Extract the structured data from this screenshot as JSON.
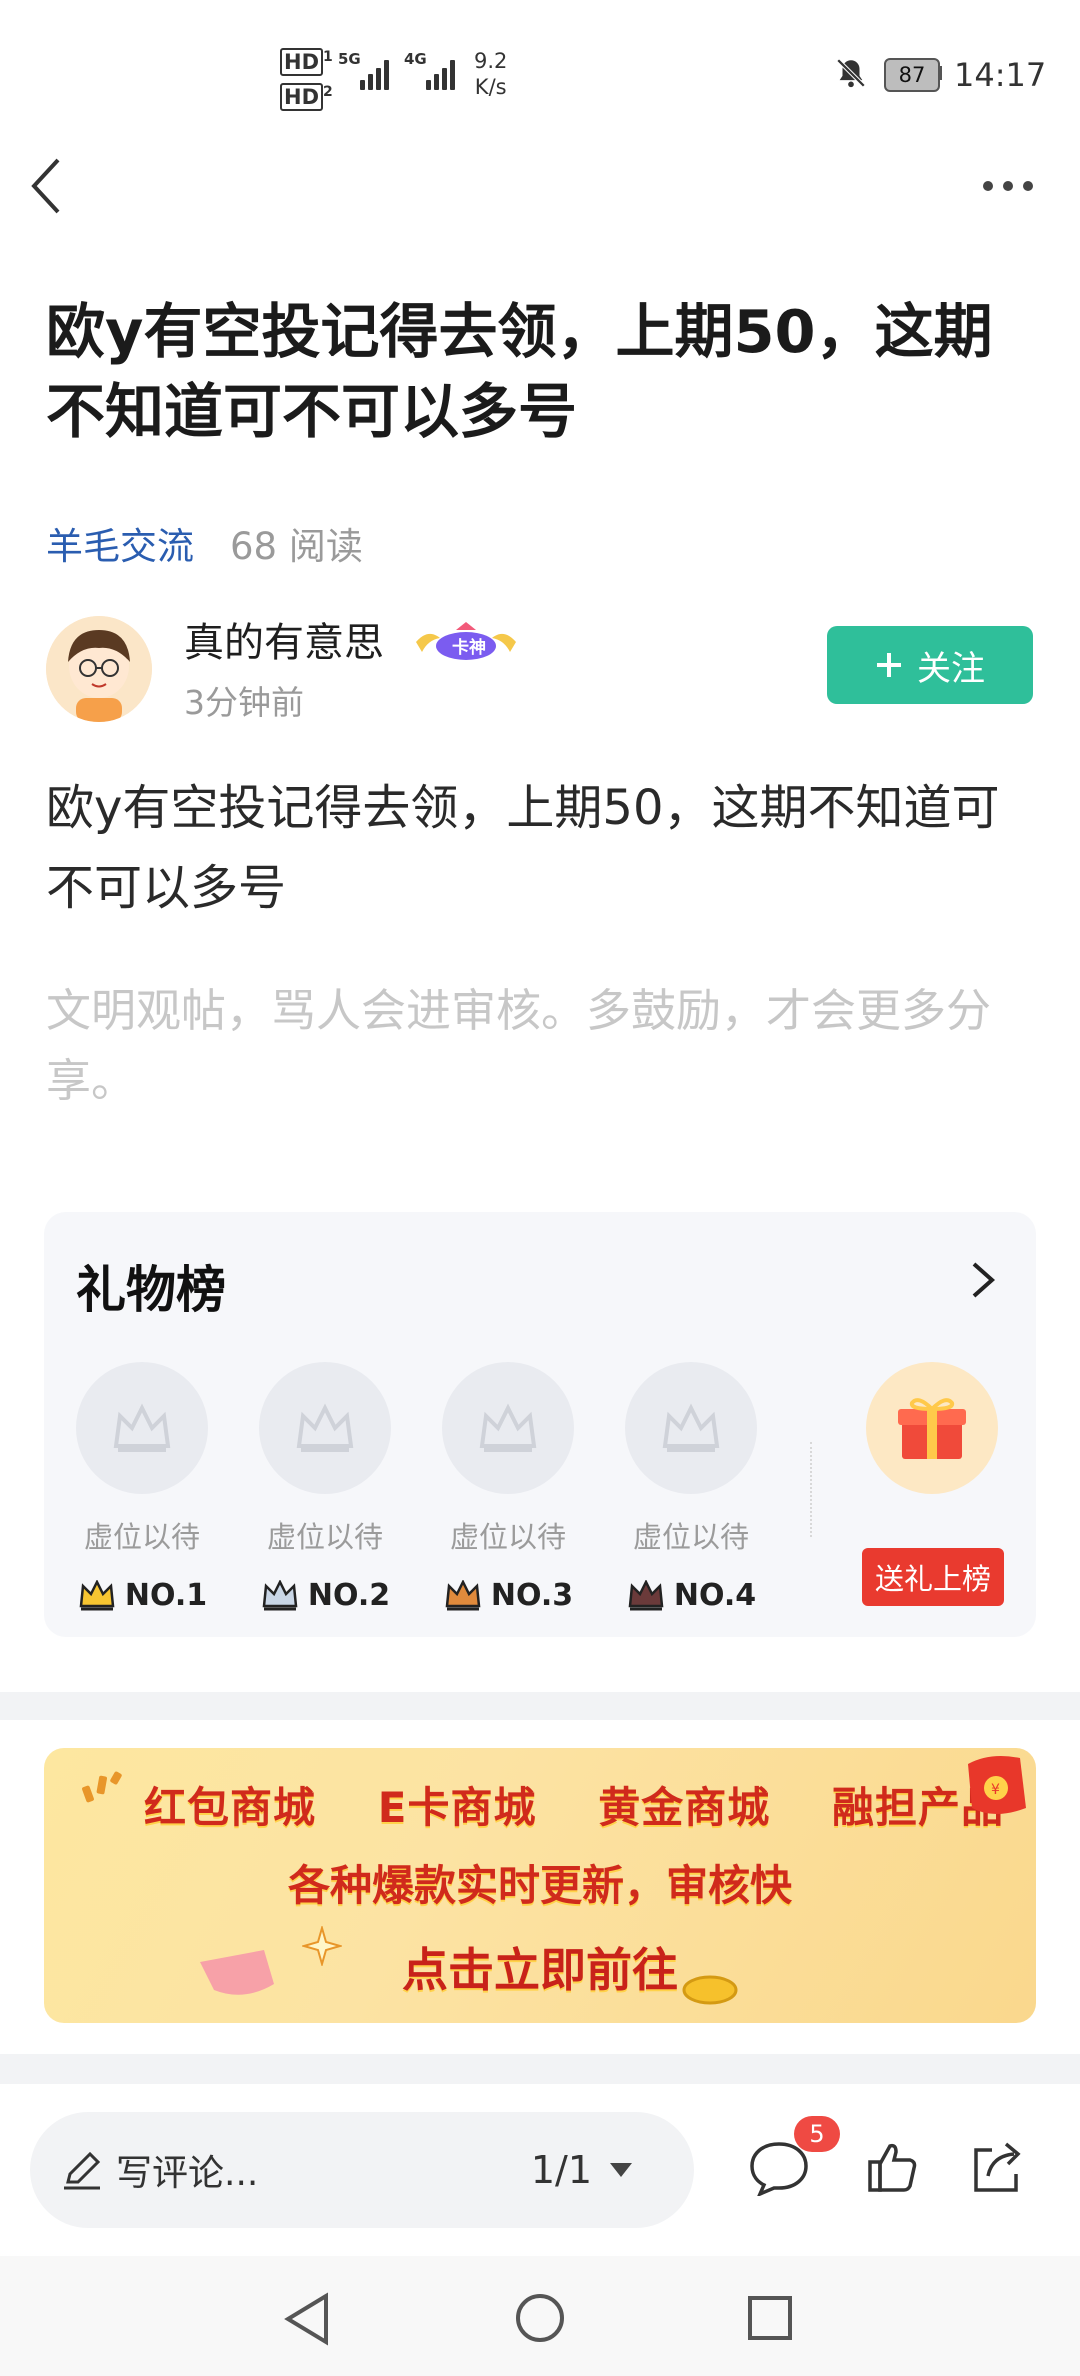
{
  "status_bar": {
    "hd1": "HD",
    "hd1_sub": "1",
    "hd2": "HD",
    "hd2_sub": "2",
    "net1": "5G",
    "net2": "4G",
    "speed_value": "9.2",
    "speed_unit": "K/s",
    "battery": "87",
    "time": "14:17"
  },
  "post": {
    "title": "欧y有空投记得去领，上期50，这期不知道可不可以多号",
    "category": "羊毛交流",
    "reads": "68 阅读",
    "author": "真的有意思",
    "author_badge": "卡神",
    "time_ago": "3分钟前",
    "follow_label": "关注",
    "body": "欧y有空投记得去领，上期50，这期不知道可不可以多号",
    "notice": "文明观帖，骂人会进审核。多鼓励，才会更多分享。"
  },
  "gift_board": {
    "title": "礼物榜",
    "slots": [
      {
        "label": "虚位以待",
        "rank": "NO.1"
      },
      {
        "label": "虚位以待",
        "rank": "NO.2"
      },
      {
        "label": "虚位以待",
        "rank": "NO.3"
      },
      {
        "label": "虚位以待",
        "rank": "NO.4"
      }
    ],
    "send_label": "送礼上榜"
  },
  "banner": {
    "items": [
      "红包商城",
      "E卡商城",
      "黄金商城",
      "融担产品"
    ],
    "subtitle": "各种爆款实时更新，审核快",
    "cta": "点击立即前往"
  },
  "bottom_bar": {
    "comment_placeholder": "写评论...",
    "pager": "1/1",
    "comment_count": "5"
  },
  "colors": {
    "accent_green": "#2fbf9a",
    "link_blue": "#2a5db0",
    "badge_red": "#ef4a43",
    "gift_red": "#e93a2f"
  }
}
